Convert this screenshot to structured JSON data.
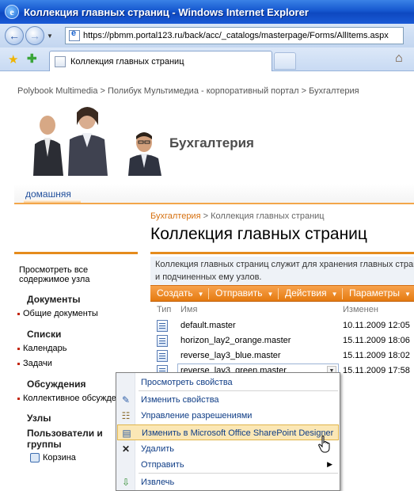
{
  "window": {
    "title": "Коллекция главных страниц - Windows Internet Explorer"
  },
  "address_bar": {
    "url": "https://pbmm.portal123.ru/back/acc/_catalogs/masterpage/Forms/AllItems.aspx"
  },
  "tab": {
    "label": "Коллекция главных страниц"
  },
  "site": {
    "breadcrumb_top": "Polybook Multimedia > Полибук Мультимедиа - корпоративный портал > Бухгалтерия",
    "title": "Бухгалтерия",
    "home_tab": "домашняя"
  },
  "page": {
    "crumb_link": "Бухгалтерия",
    "crumb_sep": " > ",
    "crumb_current": "Коллекция главных страниц",
    "title": "Коллекция главных страниц",
    "description_line1": "Коллекция главных страниц служит для хранения главных страниц,",
    "description_line2": "и подчиненных ему узлов."
  },
  "leftnav": {
    "view_all_line1": "Просмотреть все",
    "view_all_line2": "содержимое узла",
    "documents_head": "Документы",
    "shared_docs": "Общие документы",
    "lists_head": "Списки",
    "calendar": "Календарь",
    "tasks": "Задачи",
    "discussions_head": "Обсуждения",
    "team_discussion": "Коллективное обсужде",
    "sites_head": "Узлы",
    "people_line1": "Пользователи и",
    "people_line2": "группы",
    "recycle_bin": "Корзина"
  },
  "toolbar": {
    "create": "Создать",
    "send": "Отправить",
    "actions": "Действия",
    "settings": "Параметры"
  },
  "columns": {
    "type": "Тип",
    "name": "Имя",
    "modified": "Изменен"
  },
  "files": [
    {
      "name": "default.master",
      "modified": "10.11.2009 12:05"
    },
    {
      "name": "horizon_lay2_orange.master",
      "modified": "15.11.2009 18:06"
    },
    {
      "name": "reverse_lay3_blue.master",
      "modified": "15.11.2009 18:02"
    },
    {
      "name": "reverse_lay3_green.master",
      "modified": "15.11.2009 17:58"
    }
  ],
  "context_menu": {
    "view_properties": "Просмотреть свойства",
    "edit_properties": "Изменить свойства",
    "manage_permissions": "Управление разрешениями",
    "edit_in_spd": "Изменить в Microsoft Office SharePoint Designer",
    "delete": "Удалить",
    "send_to": "Отправить",
    "check_out": "Извлечь"
  }
}
